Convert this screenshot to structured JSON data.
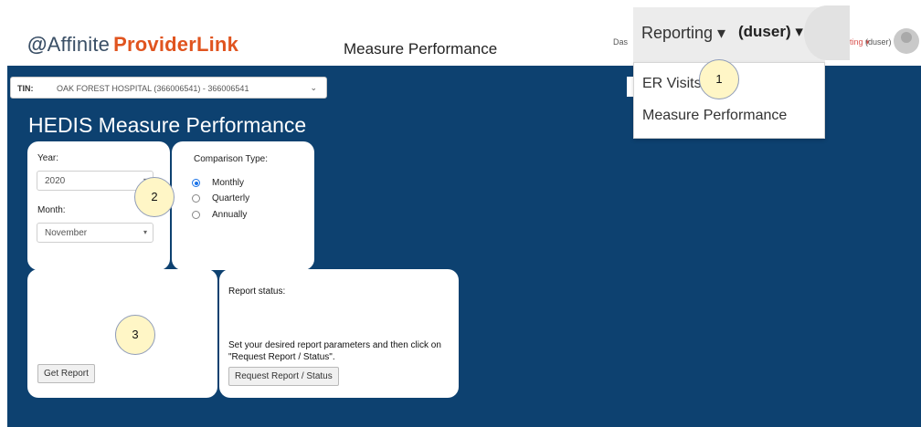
{
  "header": {
    "logo_mark": "@",
    "logo_affinite": "Affinite",
    "logo_providerlink": "ProviderLink",
    "page_title": "Measure Performance",
    "nav_dashboard_fragment": "Das",
    "nav_reporting_fragment": "ting ▾",
    "nav_user_small": "(duser) ▾"
  },
  "dropdown": {
    "reporting_label": "Reporting ▾",
    "user_label": "(duser) ▾",
    "items": [
      {
        "label": "ER Visits"
      },
      {
        "label": "Measure Performance"
      }
    ]
  },
  "tin": {
    "label": "TIN:",
    "value": "OAK FOREST HOSPITAL (366006541) - 366006541",
    "chevron": "⌄"
  },
  "main": {
    "title": "HEDIS Measure Performance"
  },
  "filters": {
    "year_label": "Year:",
    "year_value": "2020",
    "month_label": "Month:",
    "month_value": "November",
    "comparison_label": "Comparison Type:",
    "comparison_options": [
      {
        "label": "Monthly",
        "checked": true
      },
      {
        "label": "Quarterly",
        "checked": false
      },
      {
        "label": "Annually",
        "checked": false
      }
    ]
  },
  "report": {
    "get_report_label": "Get Report",
    "status_label": "Report status:",
    "instruction_line1": "Set your desired report parameters and then click on",
    "instruction_line2": "\"Request Report / Status\".",
    "request_button_label": "Request Report / Status"
  },
  "callouts": [
    "1",
    "2",
    "3"
  ],
  "colors": {
    "panel_background": "#0d4170",
    "brand_orange": "#e0541f",
    "callout_fill": "#fff6c6"
  }
}
